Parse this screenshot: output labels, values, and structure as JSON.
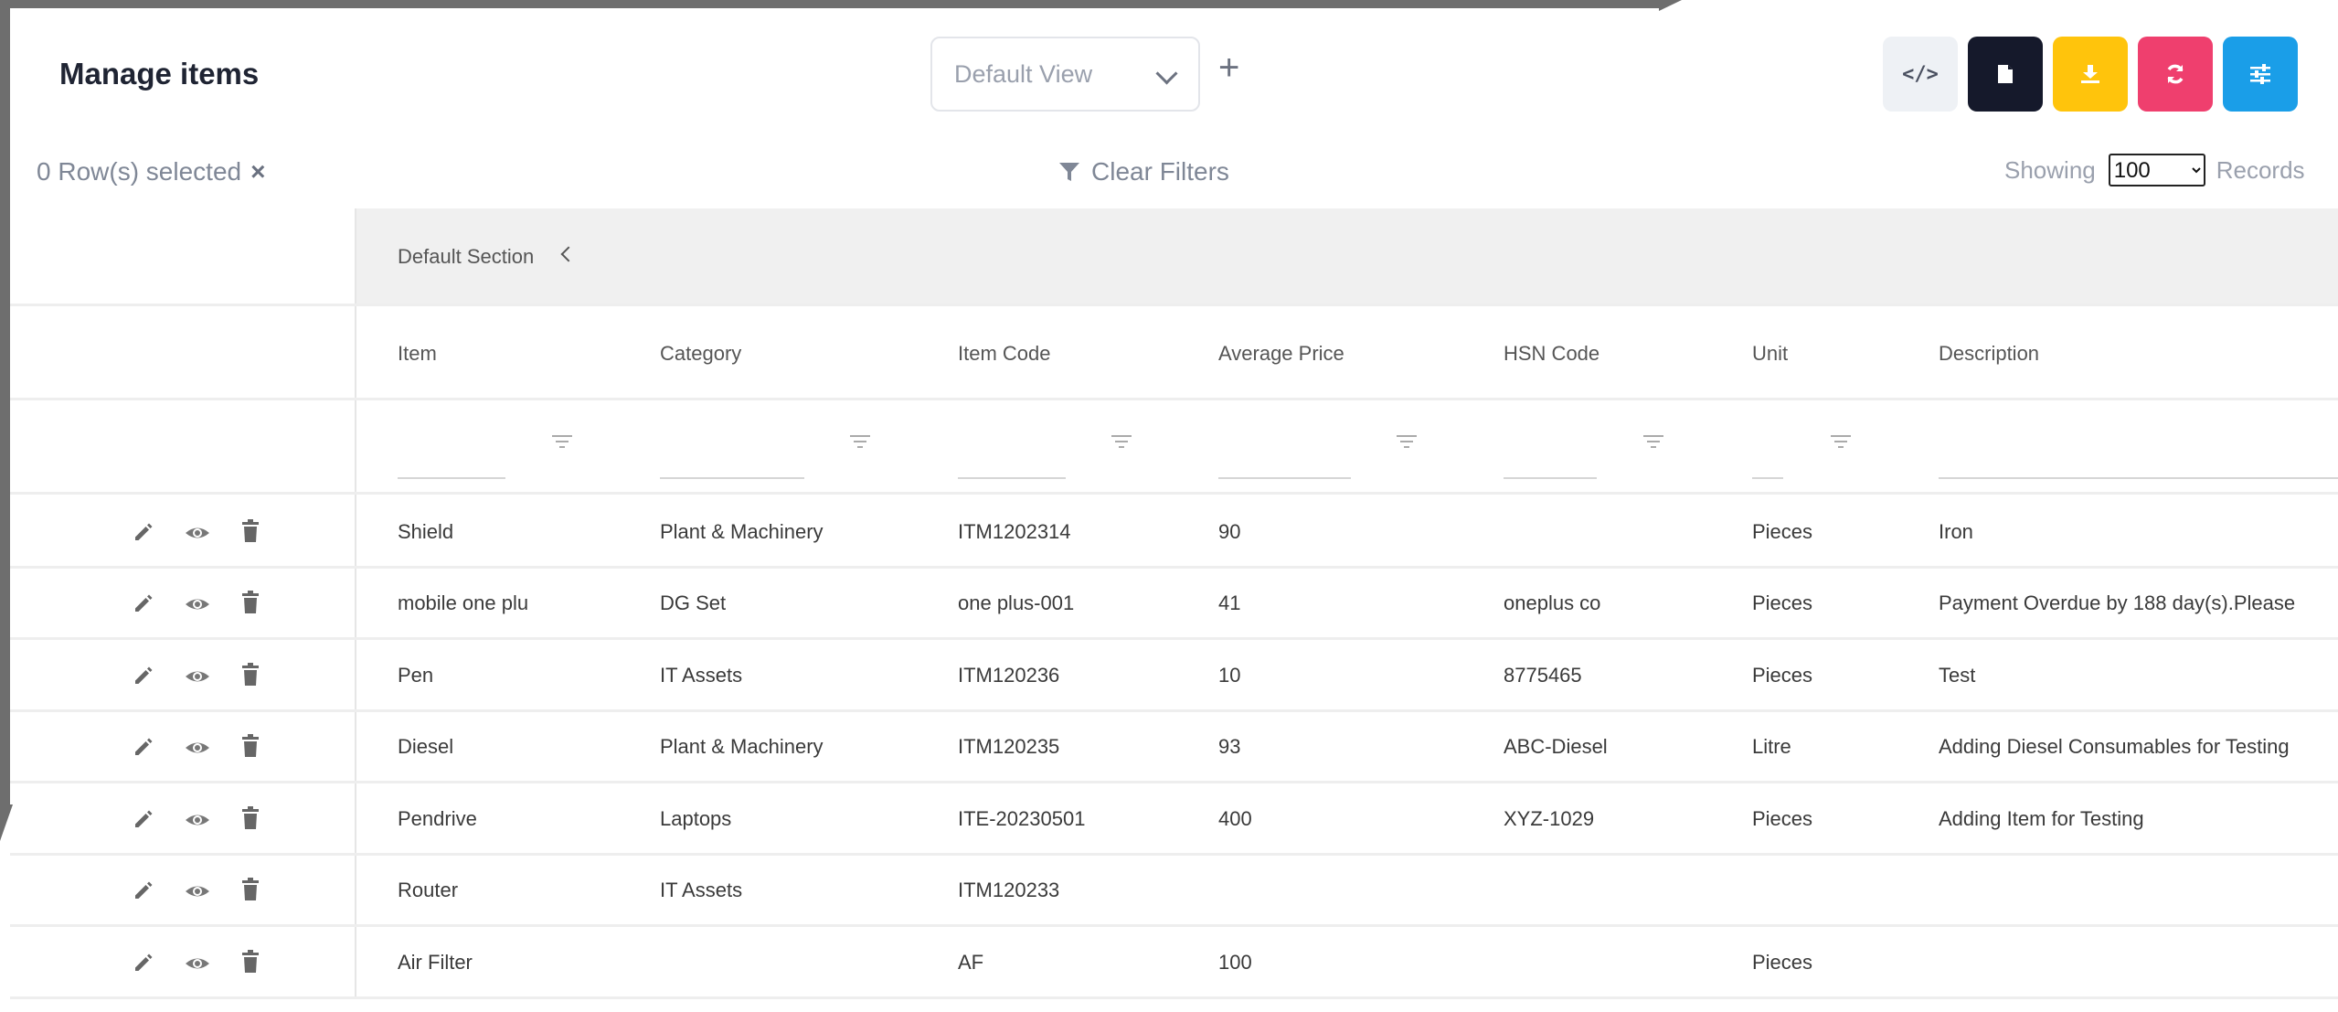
{
  "page": {
    "title": "Manage items"
  },
  "toolbar": {
    "view_select": "Default View",
    "add_icon": "plus-icon",
    "buttons": [
      {
        "name": "code",
        "icon": "code-icon",
        "color": "#eef1f5"
      },
      {
        "name": "document",
        "icon": "document-icon",
        "color": "#15192b"
      },
      {
        "name": "download",
        "icon": "download-icon",
        "color": "#ffc40c"
      },
      {
        "name": "refresh",
        "icon": "refresh-icon",
        "color": "#ef3f6e"
      },
      {
        "name": "settings",
        "icon": "sliders-icon",
        "color": "#1a9ee8"
      }
    ]
  },
  "selection": {
    "label": "0 Row(s) selected",
    "clear": "×"
  },
  "filters": {
    "clear_label": "Clear Filters"
  },
  "paging": {
    "showing": "Showing",
    "value": "100",
    "options": [
      "100"
    ],
    "records": "Records"
  },
  "section": {
    "label": "Default Section"
  },
  "table": {
    "columns": [
      "Item",
      "Category",
      "Item Code",
      "Average Price",
      "HSN Code",
      "Unit",
      "Description"
    ],
    "rows": [
      [
        "Shield",
        "Plant & Machinery",
        "ITM1202314",
        "90",
        "",
        "Pieces",
        "Iron"
      ],
      [
        "mobile one plu",
        "DG Set",
        "one plus-001",
        "41",
        "oneplus co",
        "Pieces",
        "Payment Overdue by 188 day(s).Please"
      ],
      [
        "Pen",
        "IT Assets",
        "ITM120236",
        "10",
        "8775465",
        "Pieces",
        "Test"
      ],
      [
        "Diesel",
        "Plant & Machinery",
        "ITM120235",
        "93",
        "ABC-Diesel",
        "Litre",
        "Adding Diesel Consumables for Testing"
      ],
      [
        "Pendrive",
        "Laptops",
        "ITE-20230501",
        "400",
        "XYZ-1029",
        "Pieces",
        "Adding Item for Testing"
      ],
      [
        "Router",
        "IT Assets",
        "ITM120233",
        "",
        "",
        "",
        ""
      ],
      [
        "Air Filter",
        "",
        "AF",
        "100",
        "",
        "Pieces",
        ""
      ]
    ],
    "row_actions": [
      "edit-icon",
      "view-icon",
      "delete-icon"
    ]
  }
}
